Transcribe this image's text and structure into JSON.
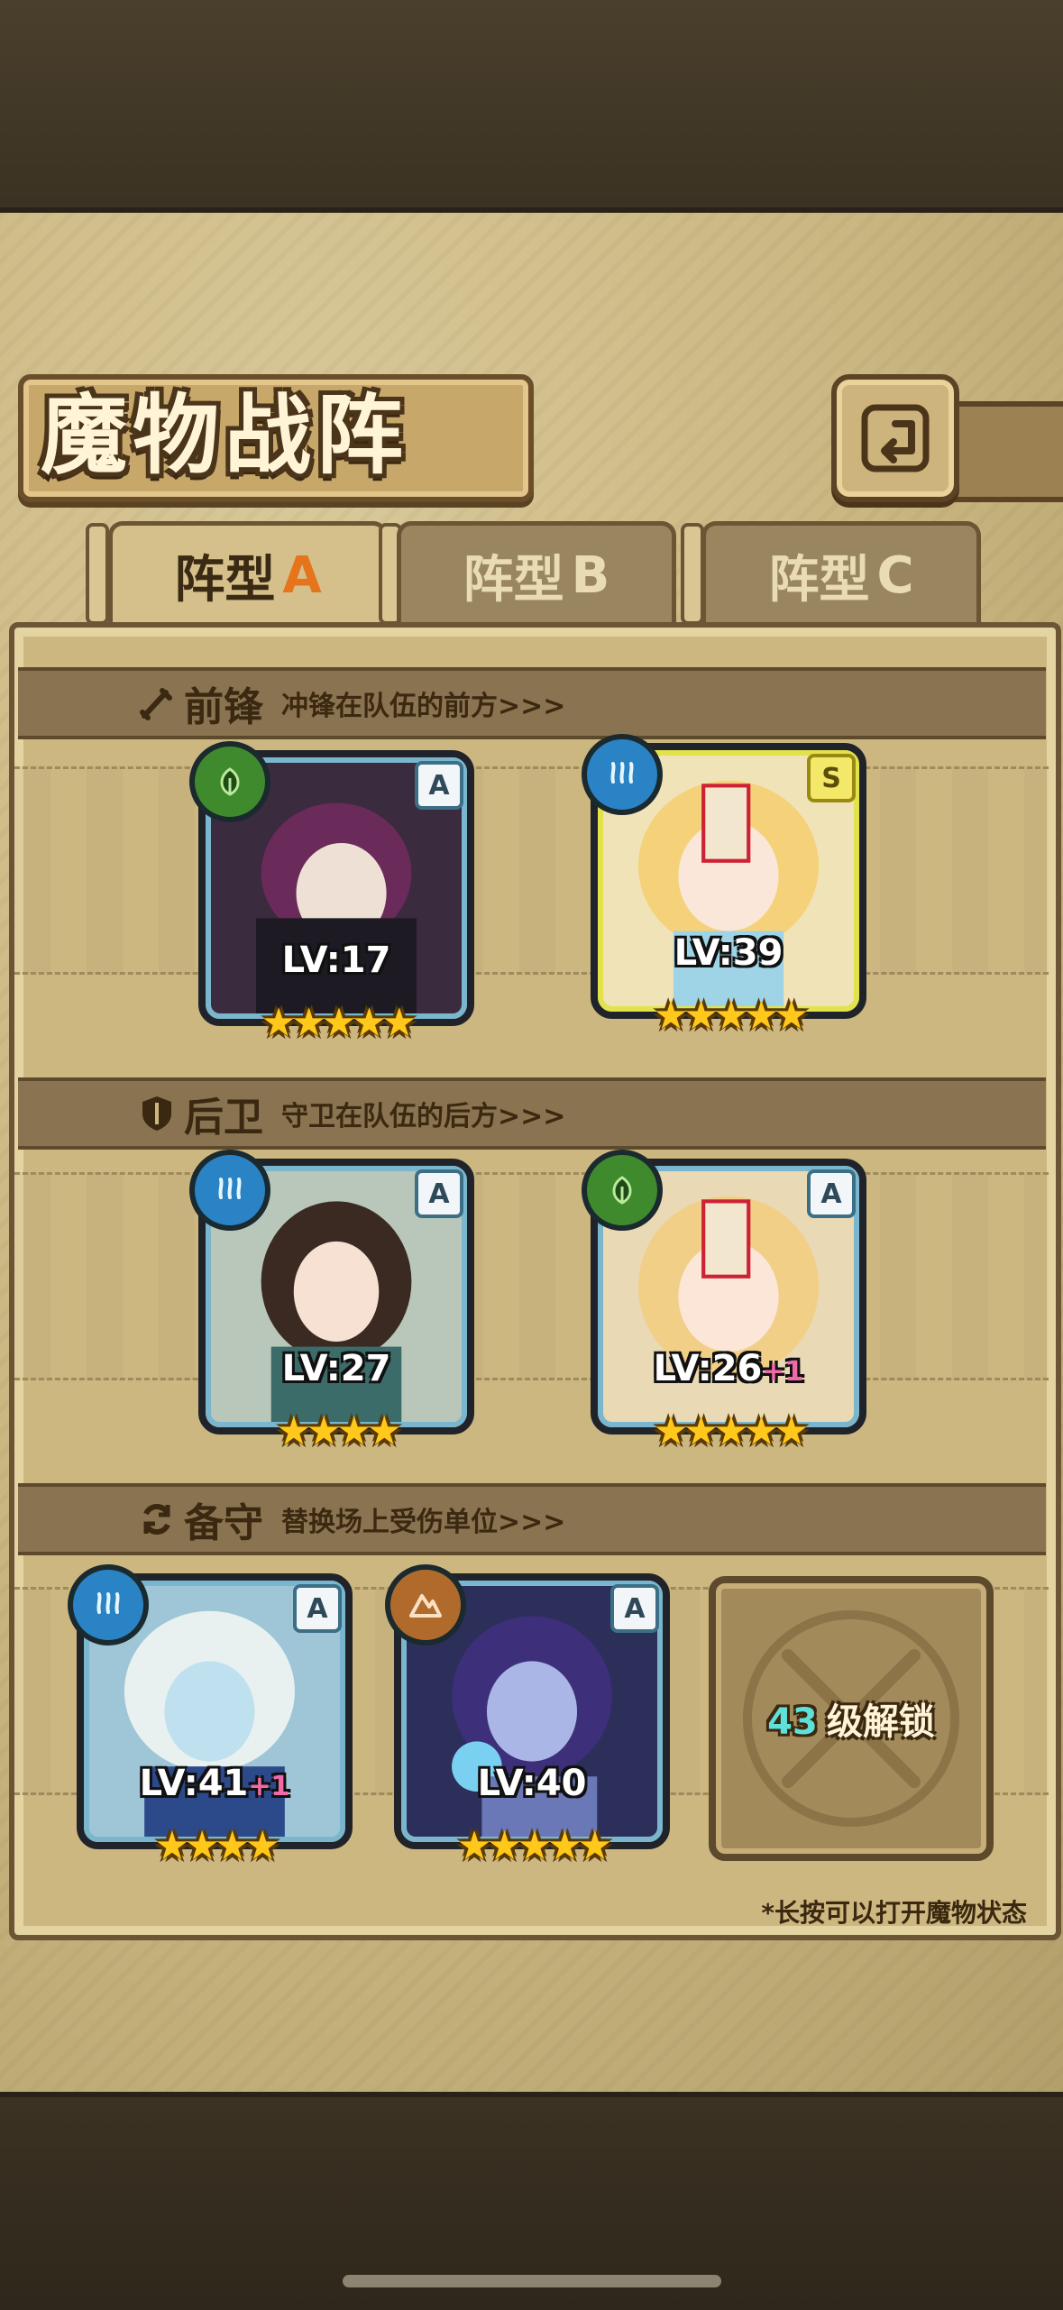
{
  "header": {
    "title": "魔物战阵"
  },
  "tabs": [
    {
      "label": "阵型",
      "letter": "A",
      "active": true
    },
    {
      "label": "阵型",
      "letter": "B",
      "active": false
    },
    {
      "label": "阵型",
      "letter": "C",
      "active": false
    }
  ],
  "sections": {
    "front": {
      "title": "前锋",
      "desc": "冲锋在队伍的前方>>>"
    },
    "back": {
      "title": "后卫",
      "desc": "守卫在队伍的后方>>>"
    },
    "reserve": {
      "title": "备守",
      "desc": "替换场上受伤单位>>>"
    }
  },
  "cards": {
    "front_1": {
      "grade": "A",
      "element": "nature-icon",
      "level": "LV:17",
      "bonus": "",
      "stars": "★★★★★"
    },
    "front_2": {
      "grade": "S",
      "element": "water-icon",
      "level": "LV:39",
      "bonus": "",
      "stars": "★★★★★"
    },
    "back_1": {
      "grade": "A",
      "element": "water-icon",
      "level": "LV:27",
      "bonus": "",
      "stars": "★★★★"
    },
    "back_2": {
      "grade": "A",
      "element": "nature-icon",
      "level": "LV:26",
      "bonus": "+1",
      "stars": "★★★★★"
    },
    "reserve_1": {
      "grade": "A",
      "element": "water-icon",
      "level": "LV:41",
      "bonus": "+1",
      "stars": "★★★★"
    },
    "reserve_2": {
      "grade": "A",
      "element": "earth-icon",
      "level": "LV:40",
      "bonus": "",
      "stars": "★★★★★"
    }
  },
  "locked_slot": {
    "level": "43",
    "text": "级解锁"
  },
  "hint": "*长按可以打开魔物状态",
  "colors": {
    "accent": "#e5741c",
    "gold_frame": "#e2e34a",
    "blue_frame": "#7ab7cf",
    "star": "#ffc81a"
  }
}
